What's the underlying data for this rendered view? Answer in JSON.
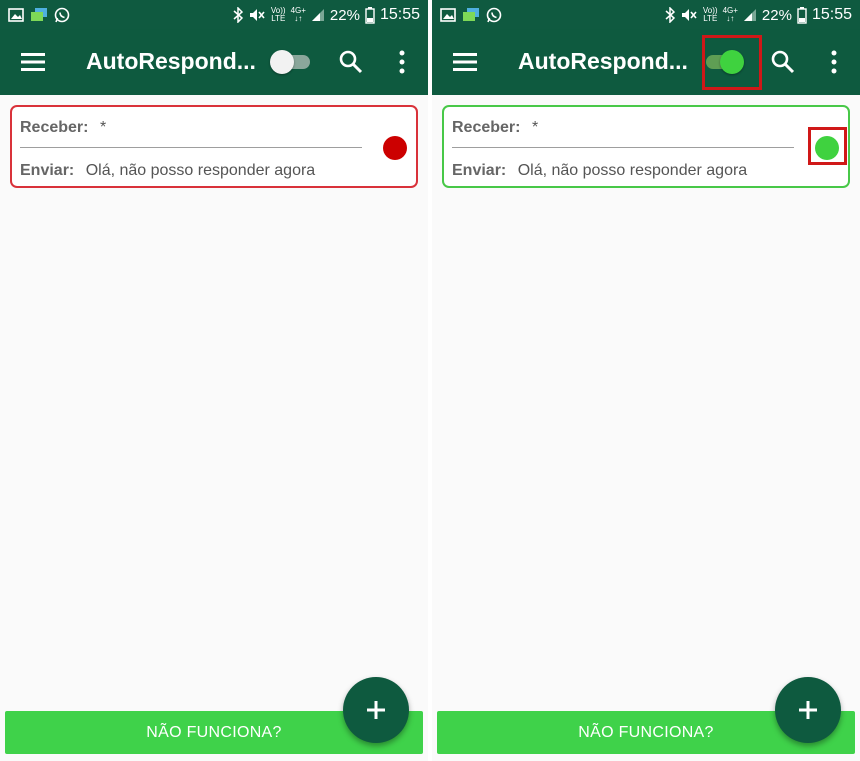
{
  "status_bar": {
    "volte_line1": "Vo))",
    "volte_line2": "LTE",
    "network_line1": "4G+",
    "network_line2": "↓↑",
    "battery_percent": "22%",
    "time": "15:55"
  },
  "app": {
    "title": "AutoRespond..."
  },
  "rule": {
    "receive_label": "Receber:",
    "receive_value": "*",
    "send_label": "Enviar:",
    "send_value": "Olá, não posso responder agora"
  },
  "screens": {
    "left": {
      "service_enabled": false,
      "rule_status": "inactive"
    },
    "right": {
      "service_enabled": true,
      "rule_status": "active"
    }
  },
  "help_button": {
    "label": "NÃO FUNCIONA?"
  },
  "icons": [
    "image-icon",
    "messages-icon",
    "whatsapp-icon",
    "bluetooth-icon",
    "mute-icon",
    "signal-icon",
    "battery-icon",
    "menu-icon",
    "search-icon",
    "more-vert-icon",
    "plus-icon"
  ],
  "colors": {
    "app_bar": "#0e5a3f",
    "status_inactive": "#cc0000",
    "status_active": "#3fd23f",
    "help_bar": "#3fd24a",
    "highlight": "#d01818"
  }
}
